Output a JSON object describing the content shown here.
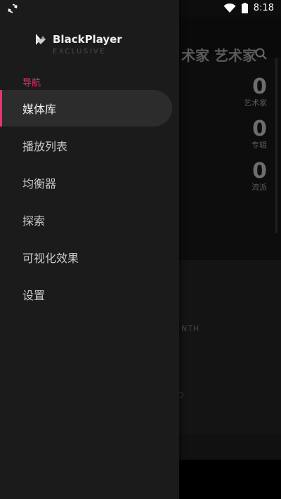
{
  "status_bar": {
    "time": "8:18",
    "left_icon": "sync-icon",
    "wifi_icon": "wifi-icon",
    "battery_icon": "battery-icon"
  },
  "background": {
    "title": "术家 艺术家",
    "search_icon": "search-icon",
    "stats": [
      {
        "value": "0",
        "label": "艺术家"
      },
      {
        "value": "0",
        "label": "专辑"
      },
      {
        "value": "0",
        "label": "流派"
      }
    ],
    "month_text": "NTH",
    "d_text": "D"
  },
  "drawer": {
    "app_name": "BlackPlayer",
    "app_edition": "EXCLUSIVE",
    "section_label": "导航",
    "items": [
      {
        "label": "媒体库",
        "active": true
      },
      {
        "label": "播放列表"
      },
      {
        "label": "均衡器"
      },
      {
        "label": "探索"
      },
      {
        "label": "可视化效果"
      },
      {
        "label": "设置"
      }
    ]
  },
  "colors": {
    "accent": "#e8356b",
    "drawer_bg": "#1b1b1b",
    "active_item_bg": "#2c2c2c"
  }
}
